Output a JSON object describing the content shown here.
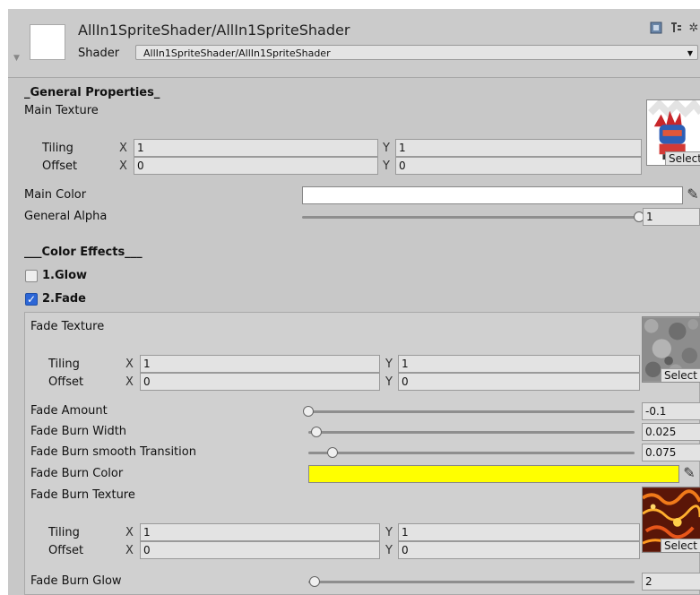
{
  "header": {
    "title": "AllIn1SpriteShader/AllIn1SpriteShader",
    "shader_label": "Shader",
    "shader_value": "AllIn1SpriteShader/AllIn1SpriteShader"
  },
  "general": {
    "section_title": "_General Properties_",
    "main_texture_label": "Main Texture",
    "tiling_label": "Tiling",
    "offset_label": "Offset",
    "x": "X",
    "y": "Y",
    "tiling_x": "1",
    "tiling_y": "1",
    "offset_x": "0",
    "offset_y": "0",
    "select": "Select",
    "main_color_label": "Main Color",
    "main_color": "#ffffff",
    "alpha_label": "General Alpha",
    "alpha_value": "1",
    "alpha_range": [
      0,
      1
    ]
  },
  "color_effects": {
    "section_title": "___Color Effects___",
    "glow_label": "1.Glow",
    "glow_checked": false,
    "fade_label": "2.Fade",
    "fade_checked": true
  },
  "fade": {
    "fade_texture_label": "Fade Texture",
    "tiling_label": "Tiling",
    "offset_label": "Offset",
    "x": "X",
    "y": "Y",
    "tiling_x": "1",
    "tiling_y": "1",
    "offset_x": "0",
    "offset_y": "0",
    "select": "Select",
    "amount_label": "Fade Amount",
    "amount_value": "-0.1",
    "amount_range": [
      -0.1,
      1
    ],
    "burn_width_label": "Fade Burn Width",
    "burn_width_value": "0.025",
    "burn_width_range": [
      0,
      1
    ],
    "burn_smooth_label": "Fade Burn smooth Transition",
    "burn_smooth_value": "0.075",
    "burn_smooth_range": [
      0,
      1
    ],
    "burn_color_label": "Fade Burn Color",
    "burn_color": "#ffff00",
    "burn_texture_label": "Fade Burn Texture",
    "burn_tiling_x": "1",
    "burn_tiling_y": "1",
    "burn_offset_x": "0",
    "burn_offset_y": "0",
    "burn_select": "Select",
    "burn_glow_label": "Fade Burn Glow",
    "burn_glow_value": "2",
    "burn_glow_range": [
      1,
      50
    ]
  },
  "icons": [
    "material-icon",
    "help-icon",
    "settings-icon",
    "eyedropper-icon",
    "checkmark-icon",
    "dropdown-arrow-icon",
    "foldout-arrow-icon"
  ]
}
